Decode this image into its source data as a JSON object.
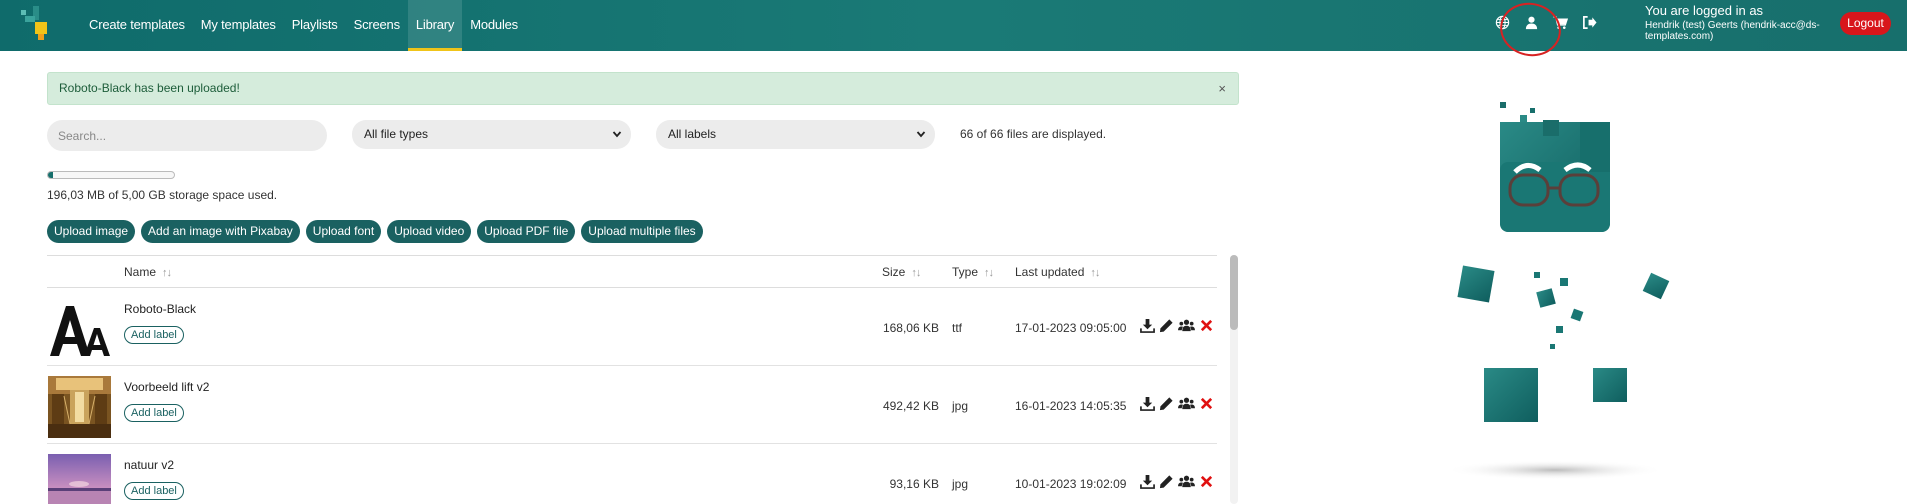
{
  "nav": {
    "items": [
      {
        "label": "Create templates"
      },
      {
        "label": "My templates"
      },
      {
        "label": "Playlists"
      },
      {
        "label": "Screens"
      },
      {
        "label": "Library",
        "active": true
      },
      {
        "label": "Modules"
      }
    ]
  },
  "header": {
    "icons": [
      "globe-icon",
      "user-icon",
      "cart-icon",
      "sign-out-icon"
    ],
    "login_title": "You are logged in as",
    "login_user": "Hendrik (test) Geerts (hendrik-acc@ds-templates.com)",
    "logout_label": "Logout"
  },
  "alert": {
    "message": "Roboto-Black has been uploaded!",
    "close": "×"
  },
  "filters": {
    "search_placeholder": "Search...",
    "file_type": "All file types",
    "labels": "All labels",
    "count_text": "66 of 66 files are displayed."
  },
  "storage": {
    "used_fraction": 0.04,
    "text": "196,03  MB of 5,00 GB storage space used."
  },
  "upload_buttons": [
    "Upload image",
    "Add an image with  Pixabay",
    "Upload font",
    "Upload video",
    "Upload  PDF file",
    "Upload multiple files"
  ],
  "table": {
    "headers": {
      "name": "Name",
      "size": "Size",
      "type": "Type",
      "updated": "Last updated"
    },
    "add_label": "Add label",
    "rows": [
      {
        "name": "Roboto-Black",
        "size": "168,06  KB",
        "type": "ttf",
        "updated": "17-01-2023 09:05:00",
        "thumb": "font"
      },
      {
        "name": "Voorbeeld lift v2",
        "size": "492,42  KB",
        "type": "jpg",
        "updated": "16-01-2023 14:05:35",
        "thumb": "lift"
      },
      {
        "name": "natuur v2",
        "size": "93,16  KB",
        "type": "jpg",
        "updated": "10-01-2023 19:02:09",
        "thumb": "nature"
      }
    ]
  },
  "colors": {
    "header": "#176f6c",
    "accent": "#1a6161",
    "active_underline": "#f0c419",
    "logout": "#d8161b",
    "delete": "#e01010",
    "alert_bg": "#d5ecdc"
  }
}
